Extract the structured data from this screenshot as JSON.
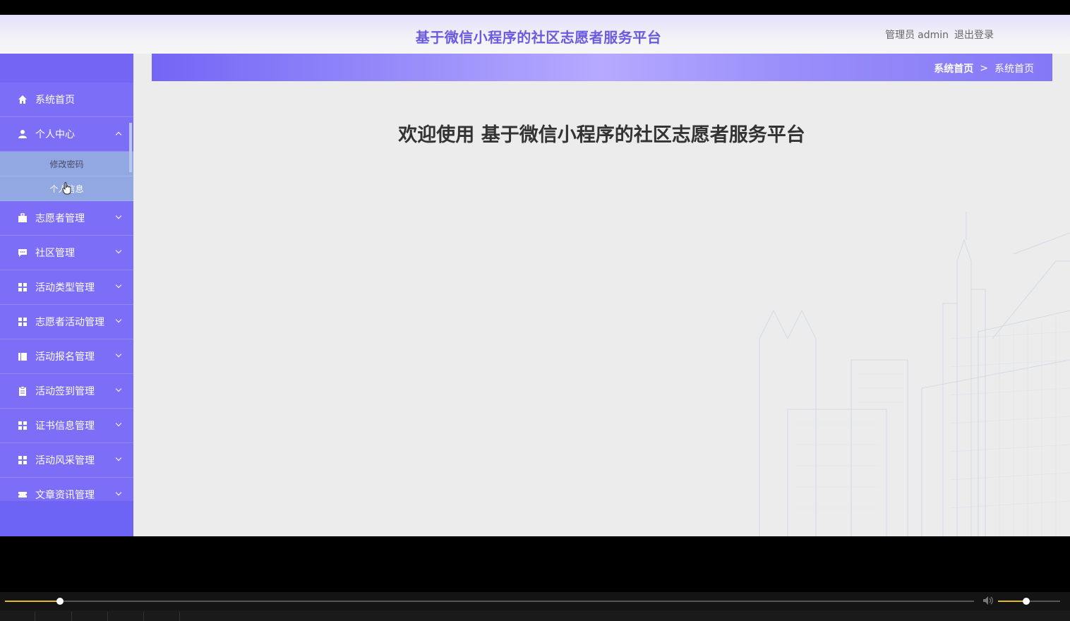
{
  "header": {
    "title": "基于微信小程序的社区志愿者服务平台",
    "role": "管理员",
    "username": "admin",
    "logout": "退出登录"
  },
  "sidebar": {
    "items": [
      {
        "label": "系统首页",
        "icon": "home-icon"
      },
      {
        "label": "个人中心",
        "icon": "user-icon",
        "expanded": true,
        "children": [
          {
            "label": "修改密码"
          },
          {
            "label": "个人信息"
          }
        ]
      },
      {
        "label": "志愿者管理",
        "icon": "briefcase-icon"
      },
      {
        "label": "社区管理",
        "icon": "chat-icon"
      },
      {
        "label": "活动类型管理",
        "icon": "grid-icon"
      },
      {
        "label": "志愿者活动管理",
        "icon": "grid-icon"
      },
      {
        "label": "活动报名管理",
        "icon": "book-icon"
      },
      {
        "label": "活动签到管理",
        "icon": "clipboard-icon"
      },
      {
        "label": "证书信息管理",
        "icon": "grid-icon"
      },
      {
        "label": "活动风采管理",
        "icon": "grid-icon"
      },
      {
        "label": "文章资讯管理",
        "icon": "ticket-icon"
      }
    ]
  },
  "breadcrumb": {
    "home": "系统首页",
    "separator": ">",
    "current": "系统首页"
  },
  "main": {
    "welcome": "欢迎使用 基于微信小程序的社区志愿者服务平台"
  },
  "player": {
    "progress": 0.057,
    "volume": 0.45
  },
  "colors": {
    "accent": "#6a5ae0",
    "sidebar": "#7c6ef6",
    "submenu": "#91a8e2",
    "progress": "#e8b82c"
  }
}
